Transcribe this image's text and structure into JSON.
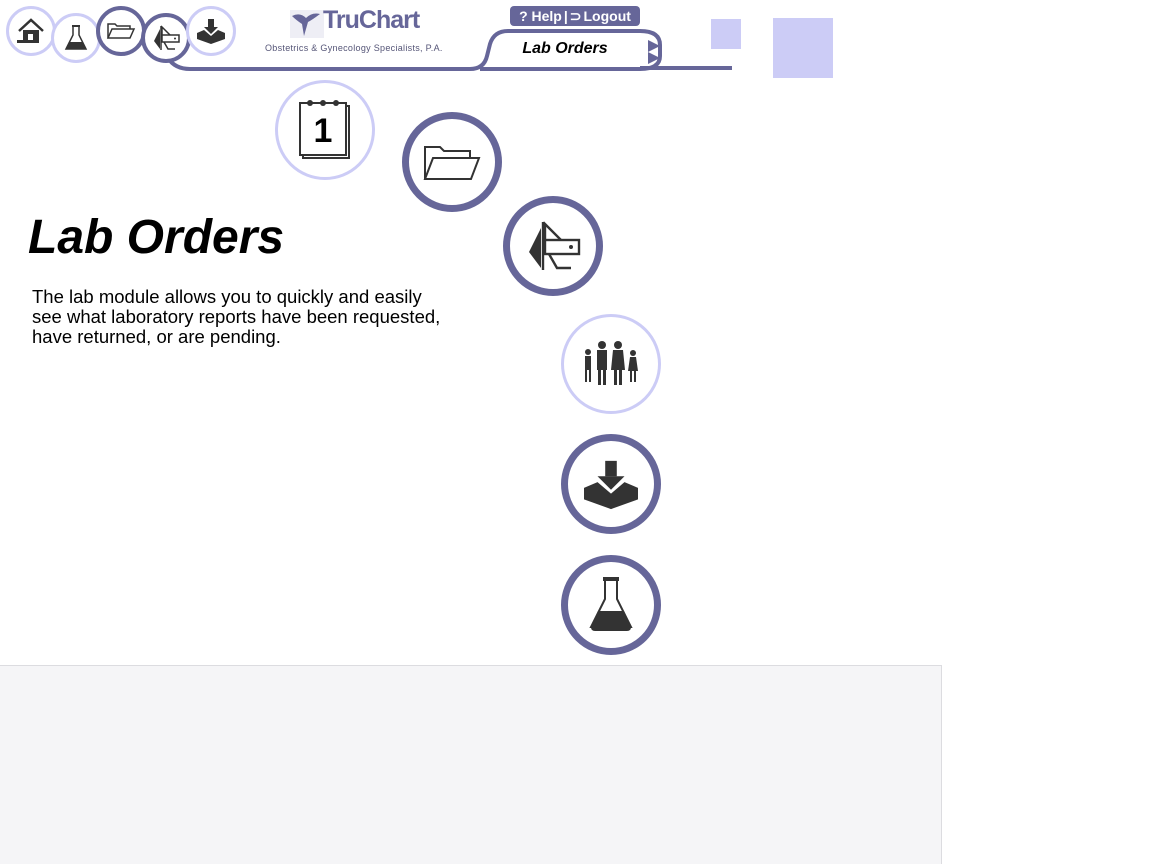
{
  "header": {
    "brand": "TruChart",
    "subtitle": "Obstetrics & Gynecology Specialists, P.A.",
    "help_label": "? Help",
    "separator": "|",
    "logout_label": "Logout",
    "logout_icon": "⊃",
    "tab_label": "Lab Orders"
  },
  "nav_icons": [
    "home-icon",
    "flask-icon",
    "folder-icon",
    "tools-icon",
    "inbox-icon"
  ],
  "main": {
    "title": "Lab Orders",
    "description": "The lab module allows you to quickly and easily see what laboratory reports have been requested, have returned,  or are pending."
  },
  "menu_icons": [
    "calendar-icon",
    "folder-icon",
    "tools-icon",
    "family-icon",
    "inbox-icon",
    "flask-icon"
  ],
  "calendar_day": "1",
  "colors": {
    "accent": "#666699",
    "light_accent": "#ccccf6",
    "icon_fill": "#333333",
    "footer_bg": "#f5f5f7"
  }
}
